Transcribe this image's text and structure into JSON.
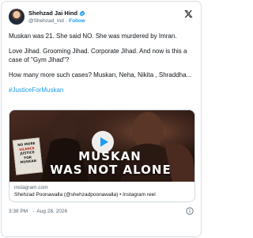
{
  "tweet": {
    "author": {
      "display_name": "Shehzad Jai Hind",
      "handle": "@Shehzad_Ind",
      "separator": "·",
      "follow_label": "Follow"
    },
    "paragraphs": [
      "Muskan was 21. She said NO. She was murdered by Imran.",
      "Love Jihad. Grooming Jihad. Corporate Jihad. And now is this a case of \"Gym Jihad\"?",
      "How many more such cases? Muskan, Neha, Nikita , Shraddha..."
    ],
    "hashtag": "#JusticeForMuskan",
    "media": {
      "overlay_line1": "MUSKAN",
      "overlay_line2": "WAS NOT ALONE",
      "sign_text": [
        "NO MORE",
        "SILENCE",
        "JUSTICE FOR",
        "MUSKAN"
      ],
      "domain": "instagram.com",
      "title": "Shehzad Poonawalla (@shehzadpoonawalla) • Instagram reel"
    },
    "footer": {
      "time": "3:38 PM",
      "separator": "·",
      "date": "Aug 28, 2026"
    }
  },
  "colors": {
    "accent": "#1d9bf0",
    "text": "#0f1419",
    "muted": "#536471",
    "border": "#d9dee3"
  },
  "icons": {
    "verified": "verified-badge-icon",
    "platform": "x-logo-icon",
    "play": "play-icon",
    "info": "info-icon"
  }
}
